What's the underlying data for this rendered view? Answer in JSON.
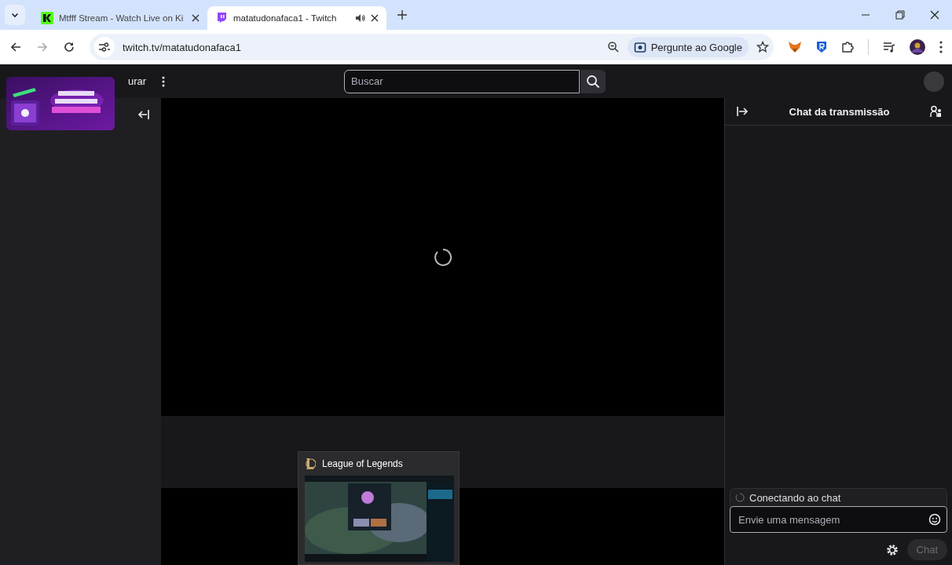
{
  "browser": {
    "tabs": [
      {
        "title": "Mtfff Stream - Watch Live on Ki",
        "selected": false,
        "audio": false
      },
      {
        "title": "matatudonafaca1 - Twitch",
        "selected": true,
        "audio": true
      }
    ],
    "address": "twitch.tv/matatudonafaca1",
    "lens_chip": "Pergunte ao Google"
  },
  "nav": {
    "menu_text": "urar",
    "search": {
      "placeholder": "Buscar"
    }
  },
  "game_popup": {
    "title": "League of Legends"
  },
  "chat": {
    "title": "Chat da transmissão",
    "status": "Conectando ao chat",
    "input": {
      "placeholder": "Envie uma mensagem"
    },
    "send_button": "Chat"
  }
}
